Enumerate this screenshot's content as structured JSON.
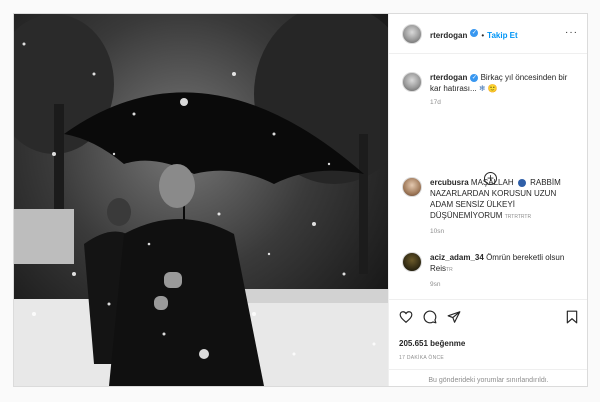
{
  "post": {
    "author": "rterdogan",
    "follow_label": "Takip Et",
    "caption": "Birkaç yıl öncesinden bir kar hatırası...",
    "caption_age": "17d",
    "likes": "205.651 beğenme",
    "time_ago": "17 DAKİKA ÖNCE",
    "restricted_notice": "Bu gönderideki yorumlar sınırlandırıldı."
  },
  "comments": [
    {
      "username": "ercubusra",
      "text_before_emoji": "MAŞALLAH",
      "text_after_emoji": "RABBİM NAZARLARDAN KORUSUN UZUN ADAM SENSİZ ÜLKEYİ DÜŞÜNEMİYORUM",
      "suffix": "TRTRTRTR",
      "age": "10sn"
    },
    {
      "username": "aciz_adam_34",
      "text": "Ömrün bereketli olsun Reis",
      "suffix": "TR",
      "age": "9sn"
    }
  ],
  "icons": {
    "more": "more-options-icon",
    "verified": "verified-badge-icon",
    "add": "add-comment-icon",
    "like": "heart-icon",
    "comment": "comment-icon",
    "share": "share-icon",
    "save": "bookmark-icon"
  }
}
